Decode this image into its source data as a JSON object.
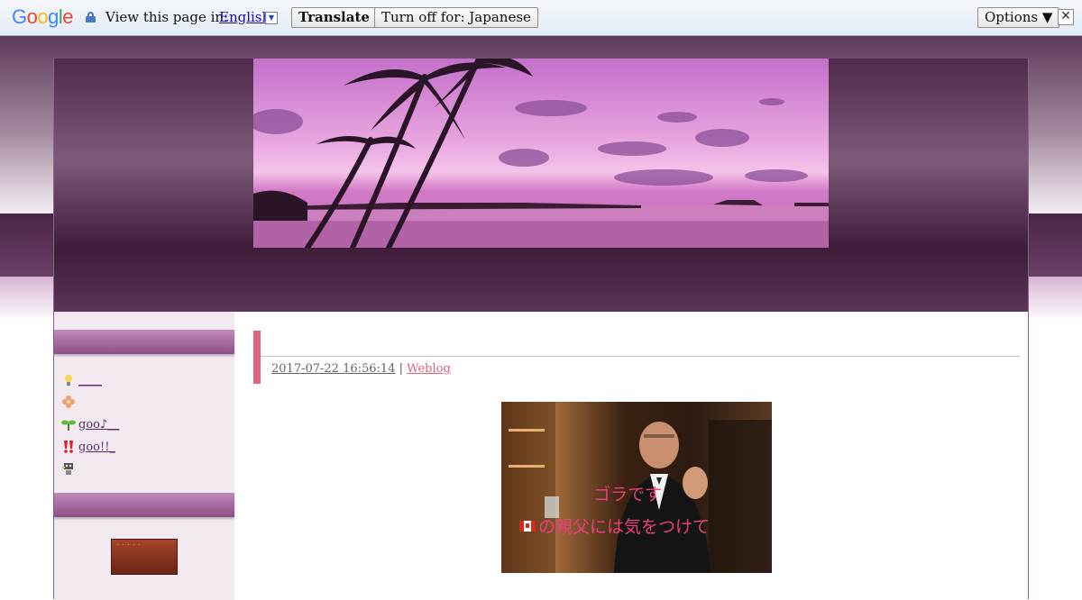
{
  "translate_bar": {
    "logo": "Google",
    "logo_colors": [
      "#4285F4",
      "#EA4335",
      "#FBBC05",
      "#4285F4",
      "#34A853",
      "#EA4335"
    ],
    "view_label": "View this page in:",
    "language": "English",
    "language_arrow": "▼",
    "translate_button": "Translate",
    "turn_off_button": "Turn off for: Japanese",
    "options_button": "Options ▼",
    "close": "✕"
  },
  "sidebar": {
    "items": [
      {
        "icon": "lightbulb-icon",
        "label": "____"
      },
      {
        "icon": "flower-icon",
        "label": ""
      },
      {
        "icon": "sprout-icon",
        "label": "goo♪__"
      },
      {
        "icon": "exclamation-icon",
        "label": "goo!!_"
      },
      {
        "icon": "robot-icon",
        "label": ""
      }
    ]
  },
  "entry": {
    "date": "2017-07-22 16:56:14",
    "separator": "|",
    "category": "Weblog",
    "photo_line1": "ゴラです",
    "photo_line2": "の親父には気をつけて"
  },
  "colors": {
    "accent": "#e0637c",
    "sidebar_band": "#a9659f",
    "photo_text": "#e8407a"
  }
}
